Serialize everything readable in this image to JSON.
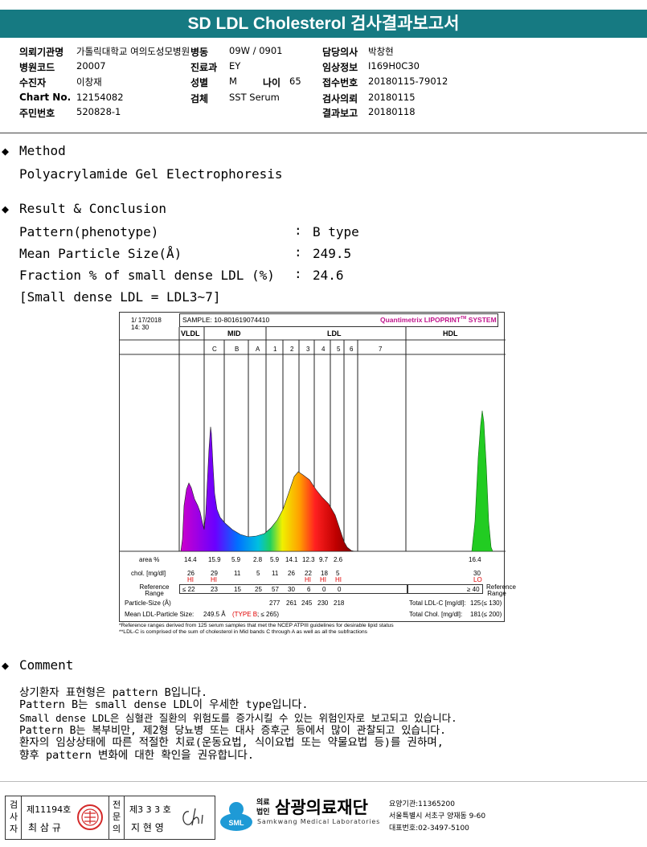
{
  "title": "SD LDL Cholesterol 검사결과보고서",
  "header": {
    "hospital_label": "의뢰기관명",
    "hospital_value": "가톨릭대학교 여의도성모병원",
    "ward_label": "병동",
    "ward_value": "09W / 0901",
    "doctor_label": "담당의사",
    "doctor_value": "박창현",
    "code_label": "병원코드",
    "code_value": "20007",
    "dept_label": "진료과",
    "dept_value": "EY",
    "clinical_label": "임상정보",
    "clinical_value": "I169H0C30",
    "patient_label": "수진자",
    "patient_value": "이창재",
    "sex_label": "성별",
    "sex_value": "M",
    "age_label": "나이",
    "age_value": "65",
    "receipt_label": "접수번호",
    "receipt_value": "20180115-79012",
    "chart_label": "Chart No.",
    "chart_value": "12154082",
    "specimen_label": "검체",
    "specimen_value": "SST Serum",
    "requested_label": "검사의뢰",
    "requested_value": "20180115",
    "id_label": "주민번호",
    "id_value": "520828-1",
    "reported_label": "결과보고",
    "reported_value": "20180118"
  },
  "method": {
    "heading": "Method",
    "text": "Polyacrylamide Gel Electrophoresis"
  },
  "result": {
    "heading": "Result & Conclusion",
    "rows": [
      {
        "label": "Pattern(phenotype)",
        "value": "B type"
      },
      {
        "label": "Mean Particle Size(Å)",
        "value": "249.5"
      },
      {
        "label": "Fraction % of small dense LDL (%)",
        "value": "24.6"
      }
    ],
    "sep": ":",
    "note": "[Small dense LDL = LDL3~7]"
  },
  "chart_data": {
    "type": "area",
    "date": "1/ 17/2018",
    "time": "14: 30",
    "sample": "SAMPLE:  10-801619074410",
    "brand": "Quantimetrix LIPOPRINT",
    "brand_tm": "TM",
    "brand_suffix": " SYSTEM",
    "bands": [
      "VLDL",
      "MID",
      "LDL",
      "HDL"
    ],
    "subbands": [
      "C",
      "B",
      "A",
      "1",
      "2",
      "3",
      "4",
      "5",
      "6",
      "7"
    ],
    "area_label": "area %",
    "area": [
      "14.4",
      "15.9",
      "5.9",
      "2.8",
      "5.9",
      "14.1",
      "12.3",
      "9.7",
      "2.6"
    ],
    "hdl_area": "16.4",
    "chol_label": "chol. [mg/dl]",
    "chol": [
      "26",
      "29",
      "11",
      "5",
      "11",
      "26",
      "22",
      "18",
      "5"
    ],
    "hdl_chol": "30",
    "flags": [
      "HI",
      "HI",
      "",
      "",
      "",
      "",
      "HI",
      "HI",
      "HI"
    ],
    "hdl_flag": "LO",
    "ref_label": "Reference Range",
    "ref": [
      "≤ 22",
      "23",
      "15",
      "25",
      "57",
      "30",
      "6",
      "0",
      "0"
    ],
    "hdl_ref": "≥ 40",
    "ref_label_right": "Reference Range",
    "particle_label": "Particle-Size (Å)",
    "particle": [
      "277",
      "261",
      "245",
      "230",
      "218"
    ],
    "total_ldl_label": "Total LDL-C [mg/dl]:",
    "total_ldl": "125",
    "total_ldl_ref": "(≤ 130)",
    "total_chol_label": "Total Chol. [mg/dl]:",
    "total_chol": "181",
    "total_chol_ref": "(≤ 200)",
    "mean_label": "Mean LDL-Particle Size:",
    "mean_value": "249.5 Å",
    "mean_type": "(TYPE B",
    "mean_ref": "; ≤ 265)",
    "foot1": "*Reference ranges derived from 125 serum samples that met the NCEP ATPIII guidelines for desirable lipid status",
    "foot2": "**LDL-C is comprised of the sum of cholesterol in Mid bands C through A as well as all the subfractions"
  },
  "comment": {
    "heading": "Comment",
    "lines": [
      "상기환자 표현형은 pattern B입니다.",
      "Pattern B는 small dense LDL이 우세한 type입니다.",
      "Small dense LDL은 심혈관 질환의 위험도를 증가시킬 수 있는 위험인자로 보고되고 있습니다.",
      "Pattern B는 복부비만, 제2형 당뇨병 또는 대사 증후군 등에서 많이 관찰되고 있습니다.",
      "환자의 임상상태에 따른 적절한 치료(운동요법, 식이요법 또는 약물요법 등)를 권하며,",
      "향후 pattern 변화에 대한 확인을 권유합니다."
    ]
  },
  "footer": {
    "tester_label": "검사자",
    "tester_no": "제11194호",
    "tester_name": "최 삼 규",
    "expert_label": "전문의",
    "expert_no": "제3 3 3 호",
    "expert_name": "지 현 영",
    "org_prefix": "의료법인",
    "org_name": "삼광의료재단",
    "org_en": "Samkwang Medical Laboratories",
    "logo_text": "SML",
    "care_no": "요양기관:11365200",
    "address": "서울특별시 서초구 양재동 9-60",
    "phone": "대표번호:02-3497-5100"
  }
}
